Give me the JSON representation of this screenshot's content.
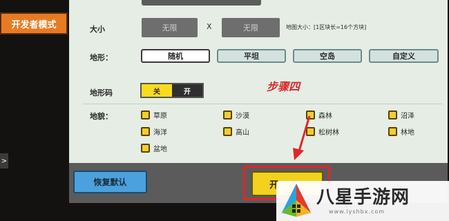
{
  "sidebar": {
    "developer_mode_label": "开发者模式",
    "collapse_arrow": ">"
  },
  "size": {
    "label": "大小",
    "width_value": "无限",
    "separator": "X",
    "height_value": "无限",
    "hint": "地图大小：[1区块长=16个方块]"
  },
  "terrain": {
    "label": "地形：",
    "options": [
      "随机",
      "平坦",
      "空岛",
      "自定义"
    ],
    "selected": "随机"
  },
  "terrain_code": {
    "label": "地形码",
    "off_label": "关",
    "on_label": "开"
  },
  "annotation": {
    "step_text": "步骤四"
  },
  "biomes": {
    "label": "地貌：",
    "items": [
      "草原",
      "沙漠",
      "森林",
      "沼泽",
      "海洋",
      "高山",
      "松树林",
      "林地",
      "盆地"
    ]
  },
  "footer": {
    "reset_label": "恢复默认",
    "start_label": "开"
  },
  "watermark": {
    "title": "八星手游网",
    "url": "www.lyshbx.com"
  },
  "colors": {
    "accent_orange": "#e77b24",
    "checkbox_yellow": "#f4cf2a",
    "highlight_red": "#e0262a",
    "reset_blue": "#4ba1dd"
  }
}
